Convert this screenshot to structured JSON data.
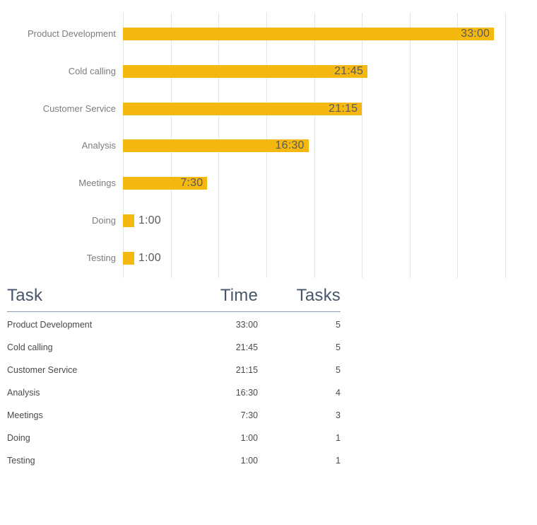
{
  "chart_data": {
    "type": "bar",
    "orientation": "horizontal",
    "title": "",
    "xlabel": "",
    "ylabel": "",
    "grid": true,
    "legend": false,
    "bar_color": "#f5b811",
    "value_label_color": "#595959",
    "category_label_color": "#7d7d7d",
    "gridline_color": "#e3e6e8",
    "categories": [
      "Product Development",
      "Cold calling",
      "Customer Service",
      "Analysis",
      "Meetings",
      "Doing",
      "Testing"
    ],
    "value_labels": [
      "33:00",
      "21:45",
      "21:15",
      "16:30",
      "7:30",
      "1:00",
      "1:00"
    ],
    "values": [
      33.0,
      21.75,
      21.25,
      16.5,
      7.5,
      1.0,
      1.0
    ],
    "unit": "hours",
    "xlim": [
      0,
      35
    ],
    "gridline_values": [
      0,
      4.25,
      8.5,
      12.75,
      17,
      21.25,
      25.5,
      29.75,
      34
    ]
  },
  "table": {
    "headers": {
      "task": "Task",
      "time": "Time",
      "tasks": "Tasks"
    },
    "rows": [
      {
        "task": "Product Development",
        "time": "33:00",
        "tasks": "5"
      },
      {
        "task": "Cold calling",
        "time": "21:45",
        "tasks": "5"
      },
      {
        "task": "Customer Service",
        "time": "21:15",
        "tasks": "5"
      },
      {
        "task": "Analysis",
        "time": "16:30",
        "tasks": "4"
      },
      {
        "task": "Meetings",
        "time": "7:30",
        "tasks": "3"
      },
      {
        "task": "Doing",
        "time": "1:00",
        "tasks": "1"
      },
      {
        "task": "Testing",
        "time": "1:00",
        "tasks": "1"
      }
    ]
  }
}
